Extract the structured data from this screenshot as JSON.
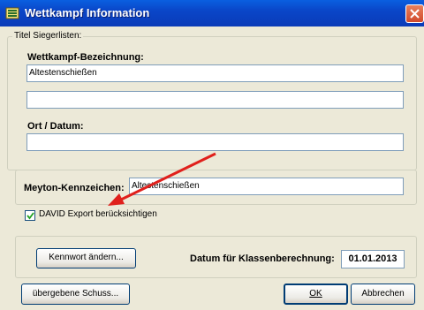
{
  "window": {
    "title": "Wettkampf Information"
  },
  "titles_group": {
    "legend": "Titel Siegerlisten:",
    "bezeichnung_label": "Wettkampf-Bezeichnung:",
    "bezeichnung_line1_value": "Altestenschießen",
    "bezeichnung_line2_value": "",
    "ort_label": "Ort / Datum:",
    "ort_value": ""
  },
  "meyton": {
    "label": "Meyton-Kennzeichen:",
    "value": "Altestenschießen"
  },
  "david_export": {
    "label": "DAVID Export berücksichtigen",
    "checked": true
  },
  "password": {
    "button_label": "Kennwort ändern..."
  },
  "klassen": {
    "label": "Datum für Klassenberechnung:",
    "value": "01.01.2013"
  },
  "footer": {
    "schuss_button_label": "übergebene Schuss...",
    "ok_label": "OK",
    "cancel_label": "Abbrechen"
  },
  "colors": {
    "titlebar": "#0a46c8",
    "window_bg": "#ece9d8",
    "annotation_arrow": "#e0201c"
  }
}
